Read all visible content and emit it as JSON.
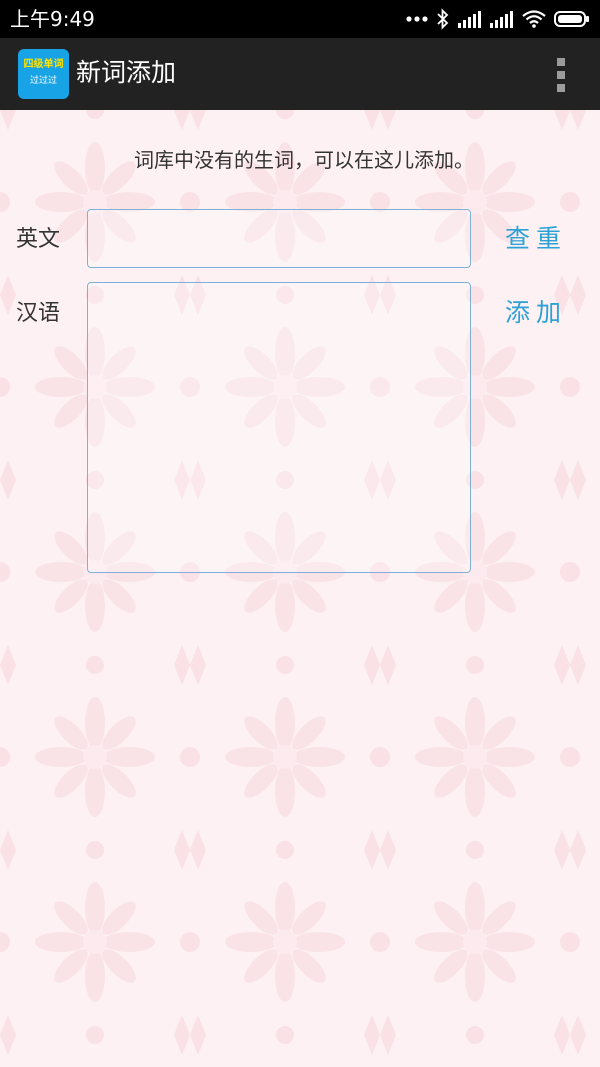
{
  "status_bar": {
    "time": "上午9:49",
    "icons": [
      "more-dots-icon",
      "bluetooth-icon",
      "signal-icon",
      "signal-icon",
      "wifi-icon",
      "battery-icon"
    ]
  },
  "app_bar": {
    "icon_line1": "四级单词",
    "icon_line2": "过过过",
    "title": "新词添加",
    "menu_icon": "overflow-menu-icon"
  },
  "form": {
    "hint": "词库中没有的生词，可以在这儿添加。",
    "english_label": "英文",
    "english_value": "",
    "chinese_label": "汉语",
    "chinese_value": "",
    "check_button": "查重",
    "add_button": "添加"
  },
  "colors": {
    "status_bar": "#000000",
    "app_bar": "#222222",
    "accent": "#2ea1d6",
    "app_icon": "#17a3e6",
    "background": "#fdf1f3"
  }
}
